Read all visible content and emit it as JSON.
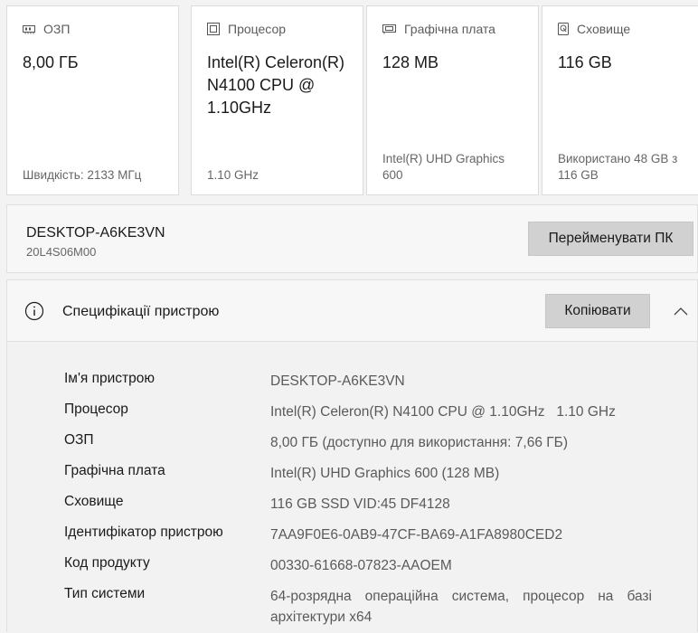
{
  "cards": [
    {
      "label": "ОЗП",
      "icon": "memory-icon",
      "value": "8,00 ГБ",
      "footer": "Швидкість: 2133 МГц"
    },
    {
      "label": "Процесор",
      "icon": "processor-icon",
      "value": "Intel(R) Celeron(R) N4100 CPU @ 1.10GHz",
      "footer": "1.10 GHz"
    },
    {
      "label": "Графічна плата",
      "icon": "graphics-card-icon",
      "value": "128 MB",
      "footer": "Intel(R) UHD Graphics 600"
    },
    {
      "label": "Сховище",
      "icon": "storage-icon",
      "value": "116 GB",
      "footer": "Використано 48 GB з 116 GB"
    }
  ],
  "device": {
    "name": "DESKTOP-A6KE3VN",
    "model": "20L4S06M00",
    "rename_label": "Перейменувати ПК"
  },
  "specs": {
    "title": "Специфікації пристрою",
    "copy_label": "Копіювати",
    "rows": [
      {
        "key": "Ім'я пристрою",
        "value": "DESKTOP-A6KE3VN"
      },
      {
        "key": "Процесор",
        "value": "Intel(R) Celeron(R) N4100 CPU @ 1.10GHz   1.10 GHz"
      },
      {
        "key": "ОЗП",
        "value": "8,00 ГБ (доступно для використання: 7,66 ГБ)"
      },
      {
        "key": "Графічна плата",
        "value": "Intel(R) UHD Graphics 600 (128 MB)"
      },
      {
        "key": "Сховище",
        "value": "116 GB SSD VID:45 DF4128"
      },
      {
        "key": "Ідентифікатор пристрою",
        "value": "7AA9F0E6-0AB9-47CF-BA69-A1FA8980CED2"
      },
      {
        "key": "Код продукту",
        "value": "00330-61668-07823-AAOEM"
      },
      {
        "key": "Тип системи",
        "value": "64-розрядна операційна система, процесор на базі архітектури x64"
      }
    ]
  }
}
